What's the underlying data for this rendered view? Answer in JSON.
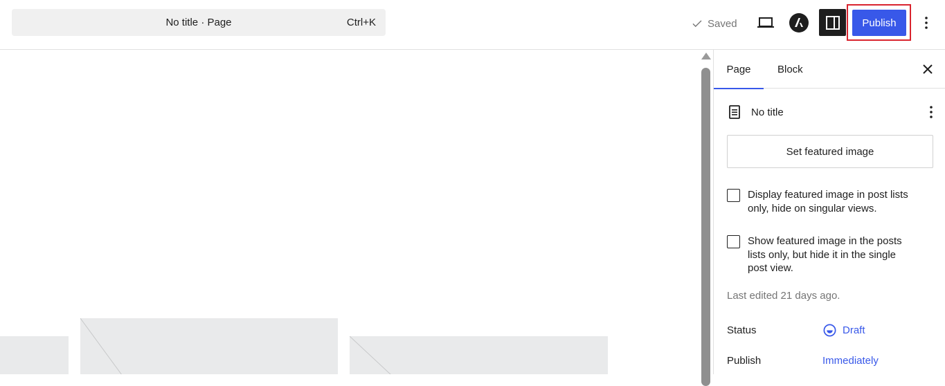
{
  "header": {
    "command_bar": {
      "title": "No title · Page",
      "shortcut": "Ctrl+K"
    },
    "saved_label": "Saved",
    "publish_label": "Publish"
  },
  "sidebar": {
    "tabs": [
      {
        "label": "Page",
        "active": true
      },
      {
        "label": "Block",
        "active": false
      }
    ],
    "document_title": "No title",
    "featured_image_button": "Set featured image",
    "checkboxes": [
      {
        "label": "Display featured image in post lists only, hide on singular views.",
        "checked": false
      },
      {
        "label": "Show featured image in the posts lists only, but hide it in the single post view.",
        "checked": false
      }
    ],
    "last_edited": "Last edited 21 days ago.",
    "status": {
      "label": "Status",
      "value": "Draft"
    },
    "publish": {
      "label": "Publish",
      "value": "Immediately"
    }
  },
  "colors": {
    "accent": "#3858e9",
    "highlight_frame": "#d9232e",
    "placeholder": "#e9eaeb"
  },
  "icons": {
    "saved": "check-icon",
    "preview": "laptop-icon",
    "astra": "astra-logo-icon",
    "settings": "sidebar-toggle-icon",
    "options": "vertical-dots-icon",
    "close": "close-icon",
    "document": "page-document-icon",
    "status": "draft-status-icon"
  }
}
